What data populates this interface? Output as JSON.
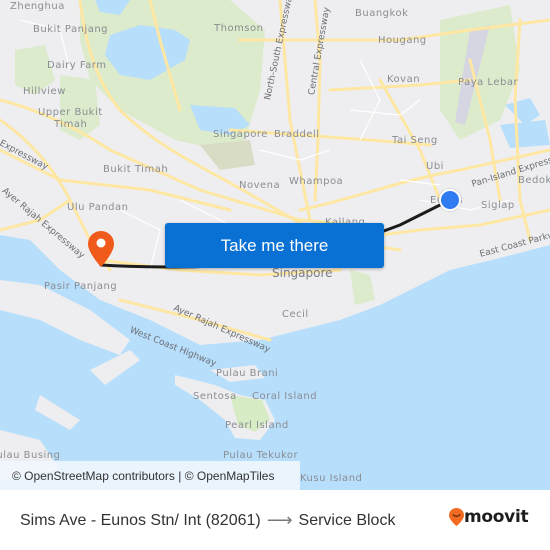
{
  "map": {
    "place_labels": [
      {
        "text": "Zhenghua",
        "kind": "area"
      },
      {
        "text": "Bukit Panjang",
        "kind": "area"
      },
      {
        "text": "Dairy Farm",
        "kind": "area"
      },
      {
        "text": "Hillview",
        "kind": "area"
      },
      {
        "text": "Upper Bukit",
        "kind": "area"
      },
      {
        "text": "Timah",
        "kind": "area"
      },
      {
        "text": "Thomson",
        "kind": "area"
      },
      {
        "text": "Buangkok",
        "kind": "area"
      },
      {
        "text": "Hougang",
        "kind": "area"
      },
      {
        "text": "Kovan",
        "kind": "area"
      },
      {
        "text": "Paya Lebar",
        "kind": "area"
      },
      {
        "text": "Singapore",
        "kind": "area"
      },
      {
        "text": "Braddell",
        "kind": "area"
      },
      {
        "text": "Tai Seng",
        "kind": "area"
      },
      {
        "text": "Ubi",
        "kind": "area"
      },
      {
        "text": "Bukit Timah",
        "kind": "area"
      },
      {
        "text": "Novena",
        "kind": "area"
      },
      {
        "text": "Whampoa",
        "kind": "area"
      },
      {
        "text": "Bedok",
        "kind": "area"
      },
      {
        "text": "Siglap",
        "kind": "area"
      },
      {
        "text": "Ulu Pandan",
        "kind": "area"
      },
      {
        "text": "Kallang",
        "kind": "area"
      },
      {
        "text": "Singapore",
        "kind": "city"
      },
      {
        "text": "Pasir Panjang",
        "kind": "area"
      },
      {
        "text": "Cecil",
        "kind": "area"
      },
      {
        "text": "Pulau Brani",
        "kind": "area"
      },
      {
        "text": "Sentosa",
        "kind": "area"
      },
      {
        "text": "Coral Island",
        "kind": "area"
      },
      {
        "text": "Pearl Island",
        "kind": "area"
      },
      {
        "text": "Pulau Busing",
        "kind": "area"
      },
      {
        "text": "Pulau Tekukor",
        "kind": "area"
      },
      {
        "text": "Kusu Island",
        "kind": "area"
      },
      {
        "text": "Eunos",
        "kind": "area"
      }
    ],
    "road_labels": [
      "North-South Expressway",
      "Central Expressway",
      "Pan-Island Expressway",
      "East Coast Parkway",
      "Ayer Rajah Expressway",
      "West Coast Highway",
      "Expressway",
      "Ayer Rajah Expressway"
    ],
    "origin_marker": {
      "label": "Sims Ave - Eunos Stn/ Int (82061)",
      "color": "#2f7cf0"
    },
    "destination_marker": {
      "label": "Service Block",
      "color": "#f05a1a"
    },
    "route_color": "#1c1c1c"
  },
  "cta": {
    "label": "Take me there",
    "color": "#0a71d4"
  },
  "attribution": "© OpenStreetMap contributors | © OpenMapTiles",
  "footer": {
    "origin": "Sims Ave - Eunos Stn/ Int (82061)",
    "arrow": "⟶",
    "destination": "Service Block",
    "brand": "moovit",
    "brand_color": "#f26b21"
  }
}
